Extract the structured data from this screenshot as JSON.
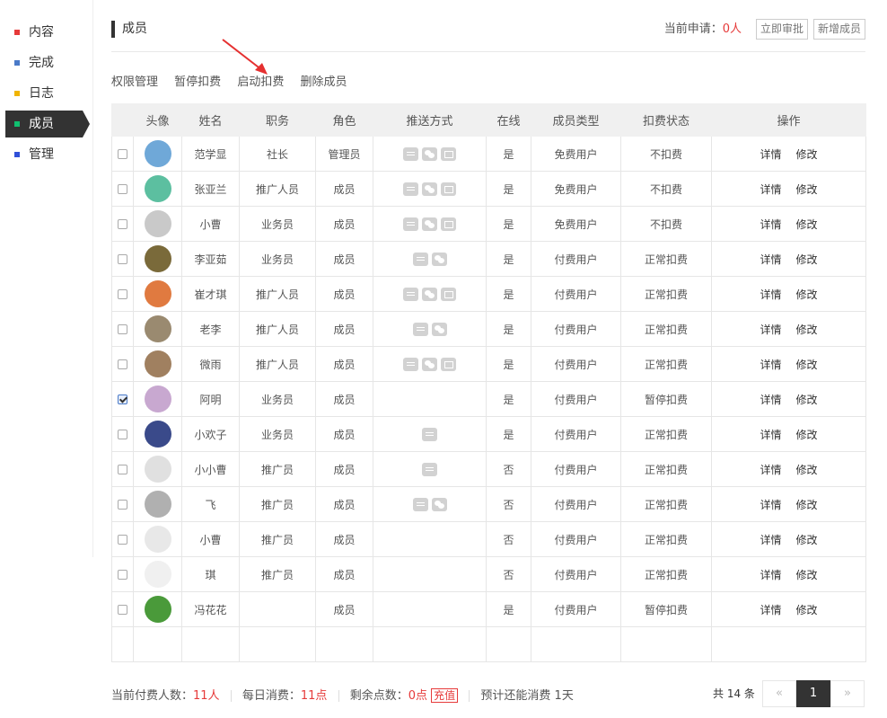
{
  "sidebar": {
    "items": [
      {
        "label": "内容",
        "color": "#e63a3a"
      },
      {
        "label": "完成",
        "color": "#4a7ac8"
      },
      {
        "label": "日志",
        "color": "#f0b400"
      },
      {
        "label": "成员",
        "color": "#10c070",
        "active": true
      },
      {
        "label": "管理",
        "color": "#3050d8"
      }
    ]
  },
  "header": {
    "title": "成员",
    "apply_label": "当前申请：",
    "apply_count": "0人",
    "btn_approve": "立即审批",
    "btn_add": "新增成员"
  },
  "actions": [
    "权限管理",
    "暂停扣费",
    "启动扣费",
    "删除成员"
  ],
  "table": {
    "columns": [
      "",
      "头像",
      "姓名",
      "职务",
      "角色",
      "推送方式",
      "在线",
      "成员类型",
      "扣费状态",
      "操作"
    ],
    "op_detail": "详情",
    "op_edit": "修改",
    "rows": [
      {
        "checked": false,
        "avatar": "#6fa8d8",
        "name": "范学显",
        "job": "社长",
        "role": "管理员",
        "push": [
          "msg",
          "wx",
          "mail"
        ],
        "online": "是",
        "type": "免费用户",
        "status": "不扣费"
      },
      {
        "checked": false,
        "avatar": "#5cbfa0",
        "name": "张亚兰",
        "job": "推广人员",
        "role": "成员",
        "push": [
          "msg",
          "wx",
          "mail"
        ],
        "online": "是",
        "type": "免费用户",
        "status": "不扣费"
      },
      {
        "checked": false,
        "avatar": "#c9c9c9",
        "name": "小曹",
        "job": "业务员",
        "role": "成员",
        "push": [
          "msg",
          "wx",
          "mail"
        ],
        "online": "是",
        "type": "免费用户",
        "status": "不扣费"
      },
      {
        "checked": false,
        "avatar": "#7a6a3a",
        "name": "李亚茹",
        "job": "业务员",
        "role": "成员",
        "push": [
          "msg",
          "wx"
        ],
        "online": "是",
        "type": "付费用户",
        "status": "正常扣费"
      },
      {
        "checked": false,
        "avatar": "#e07a40",
        "name": "崔才琪",
        "job": "推广人员",
        "role": "成员",
        "push": [
          "msg",
          "wx",
          "mail"
        ],
        "online": "是",
        "type": "付费用户",
        "status": "正常扣费"
      },
      {
        "checked": false,
        "avatar": "#9a8a70",
        "name": "老李",
        "job": "推广人员",
        "role": "成员",
        "push": [
          "msg",
          "wx"
        ],
        "online": "是",
        "type": "付费用户",
        "status": "正常扣费"
      },
      {
        "checked": false,
        "avatar": "#a08060",
        "name": "微雨",
        "job": "推广人员",
        "role": "成员",
        "push": [
          "msg",
          "wx",
          "mail"
        ],
        "online": "是",
        "type": "付费用户",
        "status": "正常扣费"
      },
      {
        "checked": true,
        "avatar": "#c8a8d0",
        "name": "阿明",
        "job": "业务员",
        "role": "成员",
        "push": [],
        "online": "是",
        "type": "付费用户",
        "status": "暂停扣费"
      },
      {
        "checked": false,
        "avatar": "#3a4a8a",
        "name": "小欢子",
        "job": "业务员",
        "role": "成员",
        "push": [
          "msg"
        ],
        "online": "是",
        "type": "付费用户",
        "status": "正常扣费"
      },
      {
        "checked": false,
        "avatar": "#e0e0e0",
        "name": "小小曹",
        "job": "推广员",
        "role": "成员",
        "push": [
          "msg"
        ],
        "online": "否",
        "type": "付费用户",
        "status": "正常扣费"
      },
      {
        "checked": false,
        "avatar": "#b0b0b0",
        "name": "飞",
        "job": "推广员",
        "role": "成员",
        "push": [
          "msg",
          "wx"
        ],
        "online": "否",
        "type": "付费用户",
        "status": "正常扣费"
      },
      {
        "checked": false,
        "avatar": "#e8e8e8",
        "name": "小曹",
        "job": "推广员",
        "role": "成员",
        "push": [],
        "online": "否",
        "type": "付费用户",
        "status": "正常扣费"
      },
      {
        "checked": false,
        "avatar": "#f0f0f0",
        "name": "琪",
        "job": "推广员",
        "role": "成员",
        "push": [],
        "online": "否",
        "type": "付费用户",
        "status": "正常扣费"
      },
      {
        "checked": false,
        "avatar": "#4a9a3a",
        "name": "冯花花",
        "job": "",
        "role": "成员",
        "push": [],
        "online": "是",
        "type": "付费用户",
        "status": "暂停扣费"
      }
    ]
  },
  "footer": {
    "paid_label": "当前付费人数：",
    "paid_value": "11人",
    "daily_label": "每日消费：",
    "daily_value": "11点",
    "remain_label": "剩余点数：",
    "remain_value": "0点",
    "recharge": "充值",
    "estimate": "预计还能消费 1天"
  },
  "pagination": {
    "total": "共 14 条",
    "prev": "«",
    "current": "1",
    "next": "»"
  },
  "colors": {
    "accent": "#e63a3a",
    "dark": "#333333"
  }
}
